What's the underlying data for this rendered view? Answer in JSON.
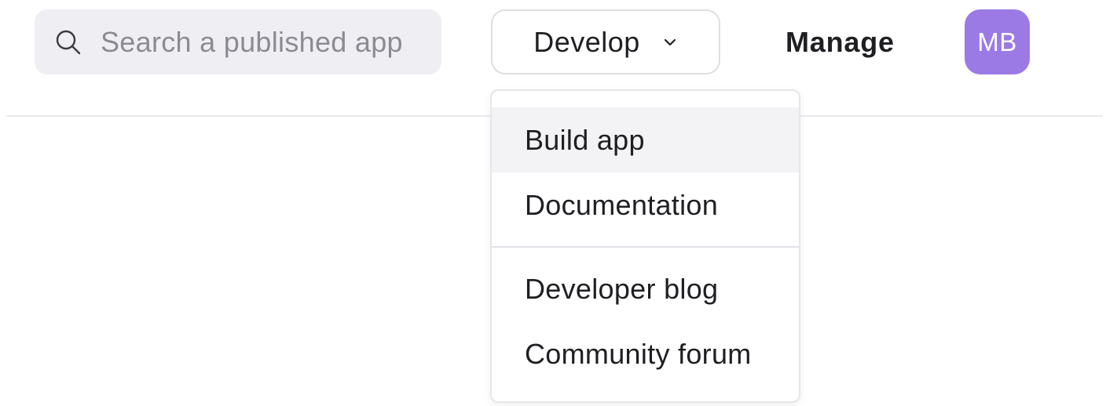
{
  "search": {
    "placeholder": "Search a published app",
    "icon": "search-icon"
  },
  "nav": {
    "develop_label": "Develop",
    "develop_icon": "chevron-down-icon",
    "manage_label": "Manage"
  },
  "avatar": {
    "initials": "MB",
    "color": "#9b7ae6"
  },
  "dropdown": {
    "items": [
      {
        "label": "Build app",
        "highlighted": true
      },
      {
        "label": "Documentation",
        "highlighted": false
      },
      {
        "label": "Developer blog",
        "highlighted": false
      },
      {
        "label": "Community forum",
        "highlighted": false
      }
    ]
  }
}
